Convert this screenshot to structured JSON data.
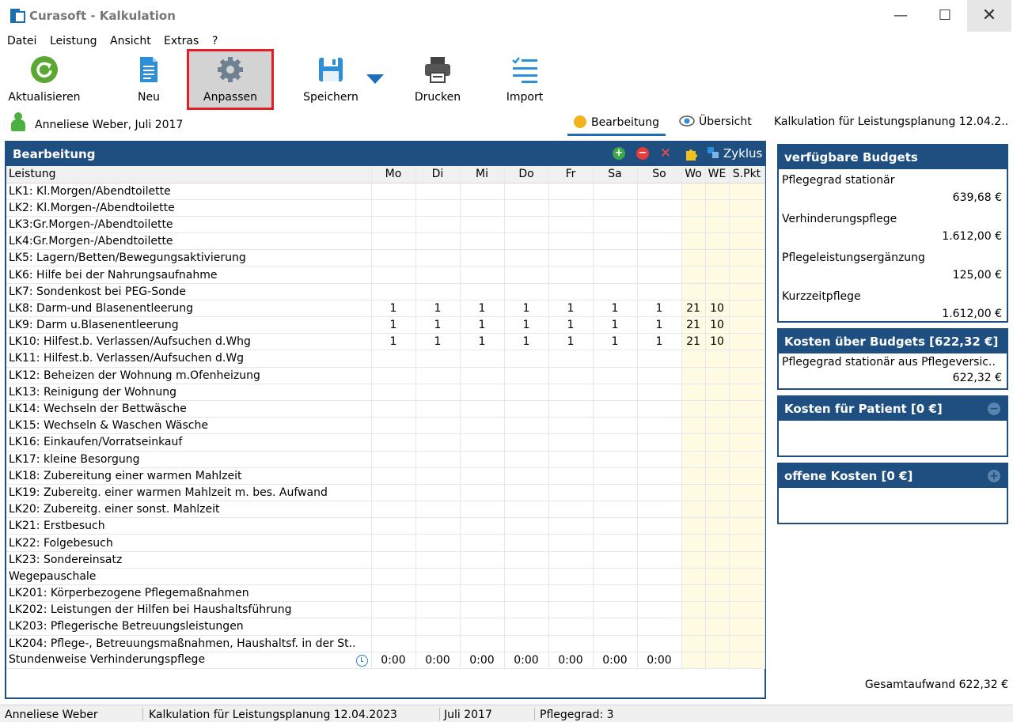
{
  "window": {
    "title": "Curasoft - Kalkulation",
    "minimize": "—",
    "maximize": "☐",
    "close": "✕"
  },
  "menu": [
    "Datei",
    "Leistung",
    "Ansicht",
    "Extras",
    "?"
  ],
  "toolbar": {
    "aktualisieren": "Aktualisieren",
    "neu": "Neu",
    "anpassen": "Anpassen",
    "speichern": "Speichern",
    "drucken": "Drucken",
    "import": "Import"
  },
  "header": {
    "user": "Anneliese Weber, Juli 2017",
    "tab_bearbeitung": "Bearbeitung",
    "tab_uebersicht": "Übersicht",
    "right_title": "Kalkulation für Leistungsplanung 12.04.2.."
  },
  "main": {
    "title": "Bearbeitung",
    "zyklus": "Zyklus",
    "columns": [
      "Leistung",
      "Mo",
      "Di",
      "Mi",
      "Do",
      "Fr",
      "Sa",
      "So",
      "Wo",
      "WE",
      "S.Pkt"
    ],
    "rows": [
      [
        "LK1: Kl.Morgen/Abendtoilette",
        "",
        "",
        "",
        "",
        "",
        "",
        "",
        "",
        "",
        ""
      ],
      [
        "LK2: Kl.Morgen-/Abendtoilette",
        "",
        "",
        "",
        "",
        "",
        "",
        "",
        "",
        "",
        ""
      ],
      [
        "LK3:Gr.Morgen-/Abendtoilette",
        "",
        "",
        "",
        "",
        "",
        "",
        "",
        "",
        "",
        ""
      ],
      [
        "LK4:Gr.Morgen-/Abendtoilette",
        "",
        "",
        "",
        "",
        "",
        "",
        "",
        "",
        "",
        ""
      ],
      [
        "LK5: Lagern/Betten/Bewegungsaktivierung",
        "",
        "",
        "",
        "",
        "",
        "",
        "",
        "",
        "",
        ""
      ],
      [
        "LK6: Hilfe bei der Nahrungsaufnahme",
        "",
        "",
        "",
        "",
        "",
        "",
        "",
        "",
        "",
        ""
      ],
      [
        "LK7: Sondenkost bei PEG-Sonde",
        "",
        "",
        "",
        "",
        "",
        "",
        "",
        "",
        "",
        ""
      ],
      [
        "LK8: Darm-und Blasenentleerung",
        "1",
        "1",
        "1",
        "1",
        "1",
        "1",
        "1",
        "21",
        "10",
        ""
      ],
      [
        "LK9: Darm u.Blasenentleerung",
        "1",
        "1",
        "1",
        "1",
        "1",
        "1",
        "1",
        "21",
        "10",
        ""
      ],
      [
        "LK10: Hilfest.b. Verlassen/Aufsuchen d.Whg",
        "1",
        "1",
        "1",
        "1",
        "1",
        "1",
        "1",
        "21",
        "10",
        ""
      ],
      [
        "LK11: Hilfest.b. Verlassen/Aufsuchen d.Wg",
        "",
        "",
        "",
        "",
        "",
        "",
        "",
        "",
        "",
        ""
      ],
      [
        "LK12: Beheizen der Wohnung m.Ofenheizung",
        "",
        "",
        "",
        "",
        "",
        "",
        "",
        "",
        "",
        ""
      ],
      [
        "LK13: Reinigung der Wohnung",
        "",
        "",
        "",
        "",
        "",
        "",
        "",
        "",
        "",
        ""
      ],
      [
        "LK14: Wechseln der Bettwäsche",
        "",
        "",
        "",
        "",
        "",
        "",
        "",
        "",
        "",
        ""
      ],
      [
        "LK15: Wechseln & Waschen Wäsche",
        "",
        "",
        "",
        "",
        "",
        "",
        "",
        "",
        "",
        ""
      ],
      [
        "LK16: Einkaufen/Vorratseinkauf",
        "",
        "",
        "",
        "",
        "",
        "",
        "",
        "",
        "",
        ""
      ],
      [
        "LK17: kleine Besorgung",
        "",
        "",
        "",
        "",
        "",
        "",
        "",
        "",
        "",
        ""
      ],
      [
        "LK18: Zubereitung einer warmen Mahlzeit",
        "",
        "",
        "",
        "",
        "",
        "",
        "",
        "",
        "",
        ""
      ],
      [
        "LK19: Zubereitg. einer warmen Mahlzeit m. bes. Aufwand",
        "",
        "",
        "",
        "",
        "",
        "",
        "",
        "",
        "",
        ""
      ],
      [
        "LK20: Zubereitg. einer sonst. Mahlzeit",
        "",
        "",
        "",
        "",
        "",
        "",
        "",
        "",
        "",
        ""
      ],
      [
        "LK21: Erstbesuch",
        "",
        "",
        "",
        "",
        "",
        "",
        "",
        "",
        "",
        ""
      ],
      [
        "LK22: Folgebesuch",
        "",
        "",
        "",
        "",
        "",
        "",
        "",
        "",
        "",
        ""
      ],
      [
        "LK23: Sondereinsatz",
        "",
        "",
        "",
        "",
        "",
        "",
        "",
        "",
        "",
        ""
      ],
      [
        "Wegepauschale",
        "",
        "",
        "",
        "",
        "",
        "",
        "",
        "",
        "",
        ""
      ],
      [
        "LK201: Körperbezogene Pflegemaßnahmen",
        "",
        "",
        "",
        "",
        "",
        "",
        "",
        "",
        "",
        ""
      ],
      [
        "LK202: Leistungen der Hilfen bei Haushaltsführung",
        "",
        "",
        "",
        "",
        "",
        "",
        "",
        "",
        "",
        ""
      ],
      [
        "LK203: Pflegerische Betreuungsleistungen",
        "",
        "",
        "",
        "",
        "",
        "",
        "",
        "",
        "",
        ""
      ],
      [
        "LK204: Pflege-, Betreuungsmaßnahmen, Haushaltsf. in der St..",
        "",
        "",
        "",
        "",
        "",
        "",
        "",
        "",
        "",
        ""
      ],
      [
        "Stundenweise Verhinderungspflege",
        "0:00",
        "0:00",
        "0:00",
        "0:00",
        "0:00",
        "0:00",
        "0:00",
        "",
        "",
        ""
      ]
    ]
  },
  "budgets": {
    "title": "verfügbare Budgets",
    "items": [
      {
        "name": "Pflegegrad stationär",
        "value": "639,68 €"
      },
      {
        "name": "Verhinderungspflege",
        "value": "1.612,00 €"
      },
      {
        "name": "Pflegeleistungsergänzung",
        "value": "125,00 €"
      },
      {
        "name": "Kurzzeitpflege",
        "value": "1.612,00 €"
      }
    ]
  },
  "kosten_budgets": {
    "title": "Kosten über Budgets [622,32 €]",
    "item_name": "Pflegegrad stationär aus Pflegeversic..",
    "item_value": "622,32 €"
  },
  "kosten_patient": {
    "title": "Kosten für Patient [0 €]",
    "toggle": "−"
  },
  "offene_kosten": {
    "title": "offene Kosten [0 €]",
    "toggle": "+"
  },
  "gesamtaufwand": "Gesamtaufwand 622,32 €",
  "status": {
    "user": "Anneliese Weber",
    "kalkulation": "Kalkulation für Leistungsplanung 12.04.2023",
    "monat": "Juli 2017",
    "pflegegrad": "Pflegegrad: 3"
  }
}
